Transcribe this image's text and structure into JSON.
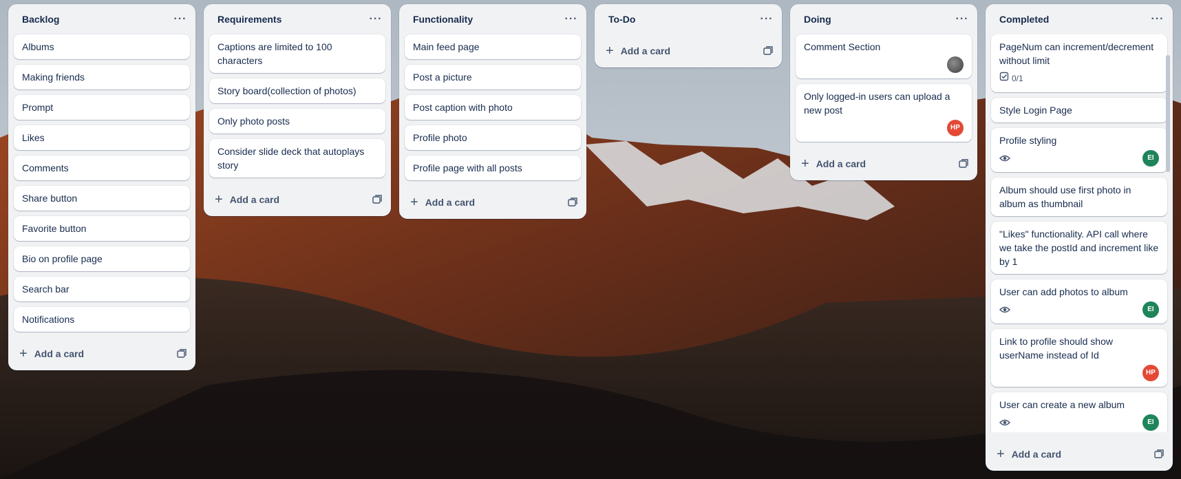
{
  "background": {
    "sky": "#c9d0d8",
    "ridge": "#8a3f22",
    "shadow": "#2a1d18",
    "snow": "#e8ecef"
  },
  "colors": {
    "list_bg": "#f1f2f4",
    "card_bg": "#ffffff",
    "text": "#172b4d",
    "avatar_hp": "#e34935",
    "avatar_ei": "#1f845a"
  },
  "lists": [
    {
      "title": "Backlog",
      "cards": [
        {
          "text": "Albums"
        },
        {
          "text": "Making friends"
        },
        {
          "text": "Prompt"
        },
        {
          "text": "Likes"
        },
        {
          "text": "Comments"
        },
        {
          "text": "Share button"
        },
        {
          "text": "Favorite button"
        },
        {
          "text": "Bio on profile page"
        },
        {
          "text": "Search bar"
        },
        {
          "text": "Notifications"
        }
      ],
      "add_label": "Add a card"
    },
    {
      "title": "Requirements",
      "cards": [
        {
          "text": "Captions are limited to 100 characters"
        },
        {
          "text": "Story board(collection of photos)"
        },
        {
          "text": "Only photo posts"
        },
        {
          "text": "Consider slide deck that autoplays story"
        }
      ],
      "add_label": "Add a card"
    },
    {
      "title": "Functionality",
      "cards": [
        {
          "text": "Main feed page"
        },
        {
          "text": "Post a picture"
        },
        {
          "text": "Post caption with photo"
        },
        {
          "text": "Profile photo"
        },
        {
          "text": "Profile page with all posts"
        }
      ],
      "add_label": "Add a card"
    },
    {
      "title": "To-Do",
      "cards": [],
      "add_label": "Add a card"
    },
    {
      "title": "Doing",
      "cards": [
        {
          "text": "Comment Section",
          "avatar": "photo"
        },
        {
          "text": "Only logged-in users can upload a new post",
          "avatar": "HP"
        }
      ],
      "add_label": "Add a card"
    },
    {
      "title": "Completed",
      "cards": [
        {
          "text": "PageNum can increment/decrement without limit",
          "checklist": "0/1"
        },
        {
          "text": "Style Login Page"
        },
        {
          "text": "Profile styling",
          "watch": true,
          "avatar": "EI"
        },
        {
          "text": "Album should use first photo in album as thumbnail"
        },
        {
          "text": "\"Likes\" functionality. API call where we take the postId and increment like by 1"
        },
        {
          "text": "User can add photos to album",
          "watch": true,
          "avatar": "EI"
        },
        {
          "text": "Link to profile should show userName instead of Id",
          "avatar": "HP"
        },
        {
          "text": "User can create a new album",
          "watch": true,
          "avatar": "EI"
        }
      ],
      "add_label": "Add a card"
    }
  ],
  "icons": {
    "menu": "ellipsis-icon",
    "add": "plus-icon",
    "template": "card-template-icon",
    "watch": "eye-icon",
    "checklist": "checklist-icon"
  }
}
